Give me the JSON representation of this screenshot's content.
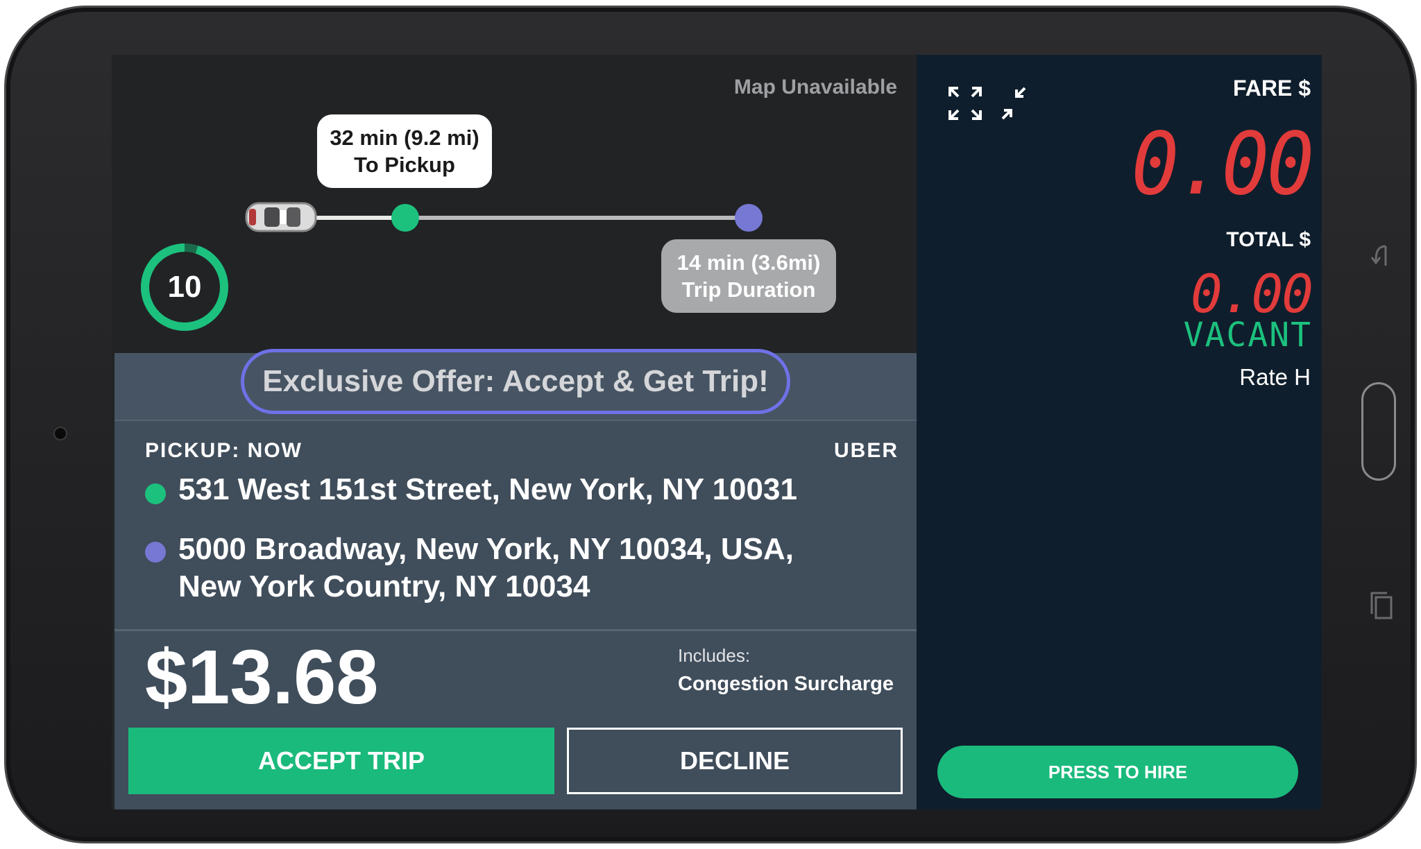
{
  "map": {
    "unavailable_text": "Map Unavailable",
    "pickup_eta": "32 min (9.2 mi)",
    "pickup_eta_label": "To Pickup",
    "trip_eta": "14 min (3.6mi)",
    "trip_eta_label": "Trip Duration",
    "countdown": "10",
    "countdown_fraction_remaining": 0.95
  },
  "offer": {
    "banner": "Exclusive Offer: Accept & Get Trip!",
    "pickup_label": "PICKUP: NOW",
    "provider": "UBER",
    "pickup_address": "531 West 151st Street, New York, NY 10031",
    "dropoff_address_line1": "5000 Broadway, New York, NY 10034, USA,",
    "dropoff_address_line2": "New York Country, NY 10034",
    "price": "$13.68",
    "includes_label": "Includes:",
    "includes_value": "Congestion Surcharge",
    "accept_label": "ACCEPT TRIP",
    "decline_label": "DECLINE"
  },
  "meter": {
    "fare_label": "FARE $",
    "fare_value": "0.00",
    "total_label": "TOTAL $",
    "total_value": "0.00",
    "status": "VACANT",
    "rate": "Rate H",
    "hire_label": "PRESS TO HIRE"
  },
  "icons": [
    "expand-icon",
    "collapse-icon",
    "car-icon",
    "back-icon",
    "recent-apps-icon"
  ],
  "colors": {
    "accent_green": "#1aba7c",
    "pickup_dot": "#1cc17e",
    "dropoff_dot": "#7678d4",
    "banner_outline": "#6e71e6",
    "meter_digits": "#e23b3b",
    "meter_bg": "#0f1e2c",
    "panel_bg": "#404d5b"
  }
}
